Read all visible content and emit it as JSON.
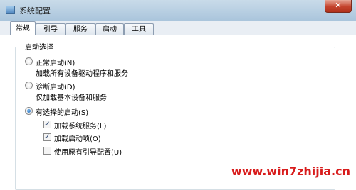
{
  "window": {
    "title": "系统配置",
    "close_label": "✕"
  },
  "tabs": [
    {
      "label": "常规",
      "active": true
    },
    {
      "label": "引导",
      "active": false
    },
    {
      "label": "服务",
      "active": false
    },
    {
      "label": "启动",
      "active": false
    },
    {
      "label": "工具",
      "active": false
    }
  ],
  "startup_selection": {
    "legend": "启动选择",
    "normal": {
      "label": "正常启动(N)",
      "description": "加载所有设备驱动程序和服务",
      "selected": false
    },
    "diagnostic": {
      "label": "诊断启动(D)",
      "description": "仅加载基本设备和服务",
      "selected": false
    },
    "selective": {
      "label": "有选择的启动(S)",
      "selected": true,
      "options": [
        {
          "label": "加载系统服务(L)",
          "checked": true
        },
        {
          "label": "加载启动项(O)",
          "checked": true
        },
        {
          "label": "使用原有引导配置(U)",
          "checked": false
        }
      ]
    }
  },
  "watermark": "www.win7zhijia.cn",
  "check_mark": "✓"
}
